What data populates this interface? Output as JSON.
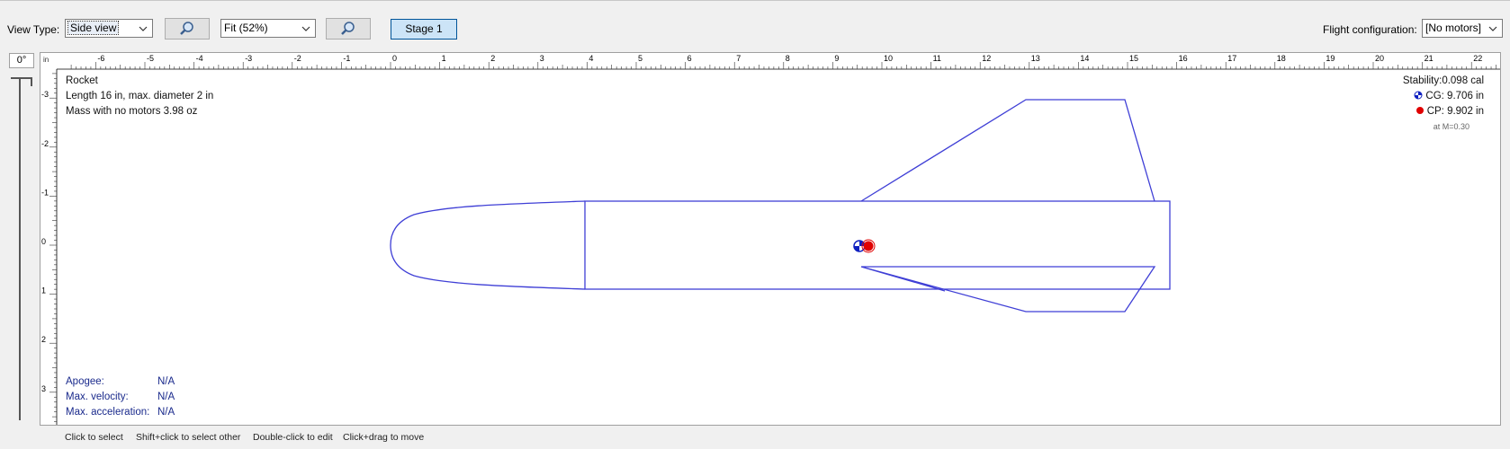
{
  "toolbar": {
    "view_type_label": "View Type:",
    "view_type_value": "Side view",
    "zoom_value": "Fit (52%)",
    "stage_label": "Stage 1",
    "flight_config_label": "Flight configuration:",
    "flight_config_value": "[No motors]"
  },
  "canvas": {
    "angle": "0°",
    "ruler_unit": "in",
    "top_ticks": [
      "-6",
      "-5",
      "-4",
      "-3",
      "-2",
      "-1",
      "0",
      "1",
      "2",
      "3",
      "4",
      "5",
      "6",
      "7",
      "8",
      "9",
      "10",
      "11",
      "12",
      "13",
      "14",
      "15",
      "16",
      "17",
      "18",
      "19",
      "20",
      "21",
      "22"
    ],
    "left_ticks": [
      "-3",
      "-2",
      "-1",
      "0",
      "1",
      "2",
      "3"
    ],
    "rocket_name": "Rocket",
    "dimensions_text": "Length 16 in, max. diameter 2 in",
    "mass_text": "Mass with no motors 3.98 oz",
    "stability_text": "Stability:0.098 cal",
    "cg_text": "CG:  9.706 in",
    "cp_text": "CP:  9.902 in",
    "mach_text": "at M=0.30",
    "stats": [
      {
        "label": "Apogee:",
        "value": "N/A"
      },
      {
        "label": "Max. velocity:",
        "value": "N/A"
      },
      {
        "label": "Max. acceleration:",
        "value": "N/A"
      }
    ],
    "colors": {
      "outline": "#3f3fd6",
      "cg": "#1020c0",
      "cp": "#e00000"
    }
  },
  "hints": [
    "Click to select",
    "Shift+click to select other",
    "Double-click to edit",
    "Click+drag to move"
  ]
}
